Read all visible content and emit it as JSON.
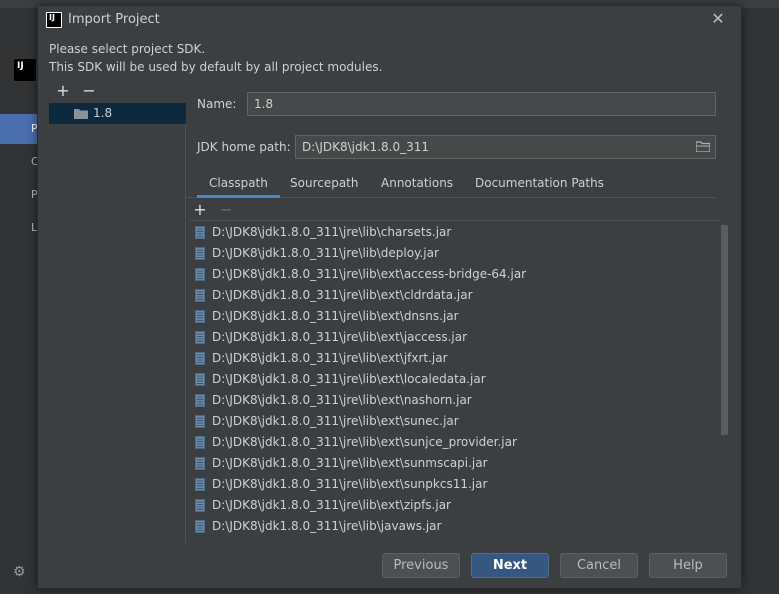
{
  "background": {
    "logo_text": "IJ",
    "nav_items": [
      "P",
      "C",
      "P",
      "L"
    ]
  },
  "dialog": {
    "title": "Import Project",
    "close_glyph": "✕",
    "description_line1": "Please select project SDK.",
    "description_line2": "This SDK will be used by default by all project modules."
  },
  "sdk_list": {
    "add": "+",
    "remove": "−",
    "items": [
      {
        "label": "1.8"
      }
    ]
  },
  "form": {
    "name_label": "Name:",
    "name_value": "1.8",
    "jdk_label": "JDK home path:",
    "jdk_value": "D:\\JDK8\\jdk1.8.0_311"
  },
  "tabs": [
    "Classpath",
    "Sourcepath",
    "Annotations",
    "Documentation Paths"
  ],
  "path_toolbar": {
    "add": "+",
    "remove": "−"
  },
  "paths": [
    "D:\\JDK8\\jdk1.8.0_311\\jre\\lib\\charsets.jar",
    "D:\\JDK8\\jdk1.8.0_311\\jre\\lib\\deploy.jar",
    "D:\\JDK8\\jdk1.8.0_311\\jre\\lib\\ext\\access-bridge-64.jar",
    "D:\\JDK8\\jdk1.8.0_311\\jre\\lib\\ext\\cldrdata.jar",
    "D:\\JDK8\\jdk1.8.0_311\\jre\\lib\\ext\\dnsns.jar",
    "D:\\JDK8\\jdk1.8.0_311\\jre\\lib\\ext\\jaccess.jar",
    "D:\\JDK8\\jdk1.8.0_311\\jre\\lib\\ext\\jfxrt.jar",
    "D:\\JDK8\\jdk1.8.0_311\\jre\\lib\\ext\\localedata.jar",
    "D:\\JDK8\\jdk1.8.0_311\\jre\\lib\\ext\\nashorn.jar",
    "D:\\JDK8\\jdk1.8.0_311\\jre\\lib\\ext\\sunec.jar",
    "D:\\JDK8\\jdk1.8.0_311\\jre\\lib\\ext\\sunjce_provider.jar",
    "D:\\JDK8\\jdk1.8.0_311\\jre\\lib\\ext\\sunmscapi.jar",
    "D:\\JDK8\\jdk1.8.0_311\\jre\\lib\\ext\\sunpkcs11.jar",
    "D:\\JDK8\\jdk1.8.0_311\\jre\\lib\\ext\\zipfs.jar",
    "D:\\JDK8\\jdk1.8.0_311\\jre\\lib\\javaws.jar"
  ],
  "buttons": {
    "previous": "Previous",
    "next": "Next",
    "cancel": "Cancel",
    "help": "Help"
  },
  "colors": {
    "accent": "#4a88c7",
    "primary_button": "#365880",
    "selection": "#0d293e"
  }
}
